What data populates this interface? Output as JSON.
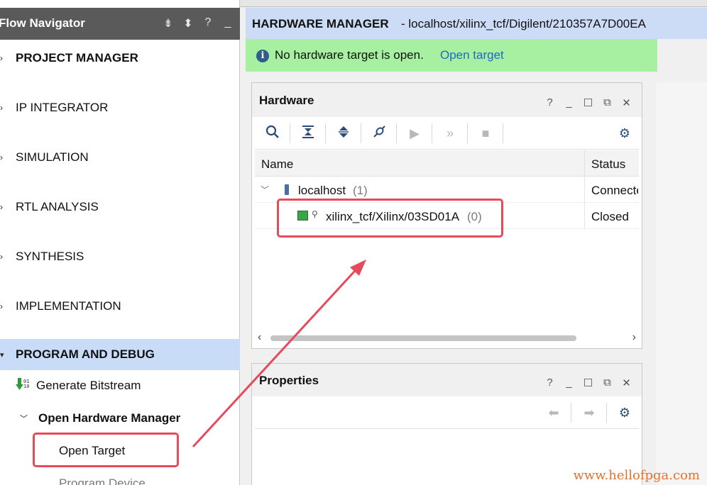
{
  "flow_navigator": {
    "title": "Flow Navigator",
    "header_icons": [
      "collapse-all-icon",
      "expand-icon",
      "help-icon",
      "minimize-icon"
    ],
    "sections": [
      {
        "label": "PROJECT MANAGER",
        "bold": true
      },
      {
        "label": "IP INTEGRATOR"
      },
      {
        "label": "SIMULATION"
      },
      {
        "label": "RTL ANALYSIS"
      },
      {
        "label": "SYNTHESIS"
      },
      {
        "label": "IMPLEMENTATION"
      },
      {
        "label": "PROGRAM AND DEBUG",
        "bold": true,
        "active": true
      }
    ],
    "program_debug": {
      "generate_bitstream": "Generate Bitstream",
      "open_hardware_manager": "Open Hardware Manager",
      "open_target": "Open Target",
      "program_device": "Program Device"
    }
  },
  "hardware_manager": {
    "title": "HARDWARE MANAGER",
    "path": "- localhost/xilinx_tcf/Digilent/210357A7D00EA",
    "info_message": "No hardware target is open.",
    "info_link": "Open target"
  },
  "hardware_panel": {
    "title": "Hardware",
    "controls": [
      "?",
      "minimize",
      "maximize",
      "float",
      "close"
    ],
    "toolbar": [
      "search-icon",
      "collapse-all-icon",
      "expand-all-icon",
      "auto-connect-icon",
      "run-icon",
      "run-all-icon",
      "stop-icon",
      "settings-icon"
    ],
    "columns": [
      "Name",
      "Status"
    ],
    "rows": [
      {
        "name": "localhost",
        "count": "(1)",
        "status": "Connected"
      },
      {
        "name": "xilinx_tcf/Xilinx/03SD01A",
        "count": "(0)",
        "status": "Closed"
      }
    ]
  },
  "properties_panel": {
    "title": "Properties",
    "toolbar": [
      "back-icon",
      "forward-icon",
      "settings-icon"
    ]
  },
  "watermark": "www.hellofpga.com",
  "colors": {
    "header_dark": "#5a5a5a",
    "active_section": "#c9dcf7",
    "info_bar": "#a8f0a1",
    "link": "#1f67c9",
    "annotation_red": "#e64b5b",
    "watermark": "#e7712d"
  }
}
